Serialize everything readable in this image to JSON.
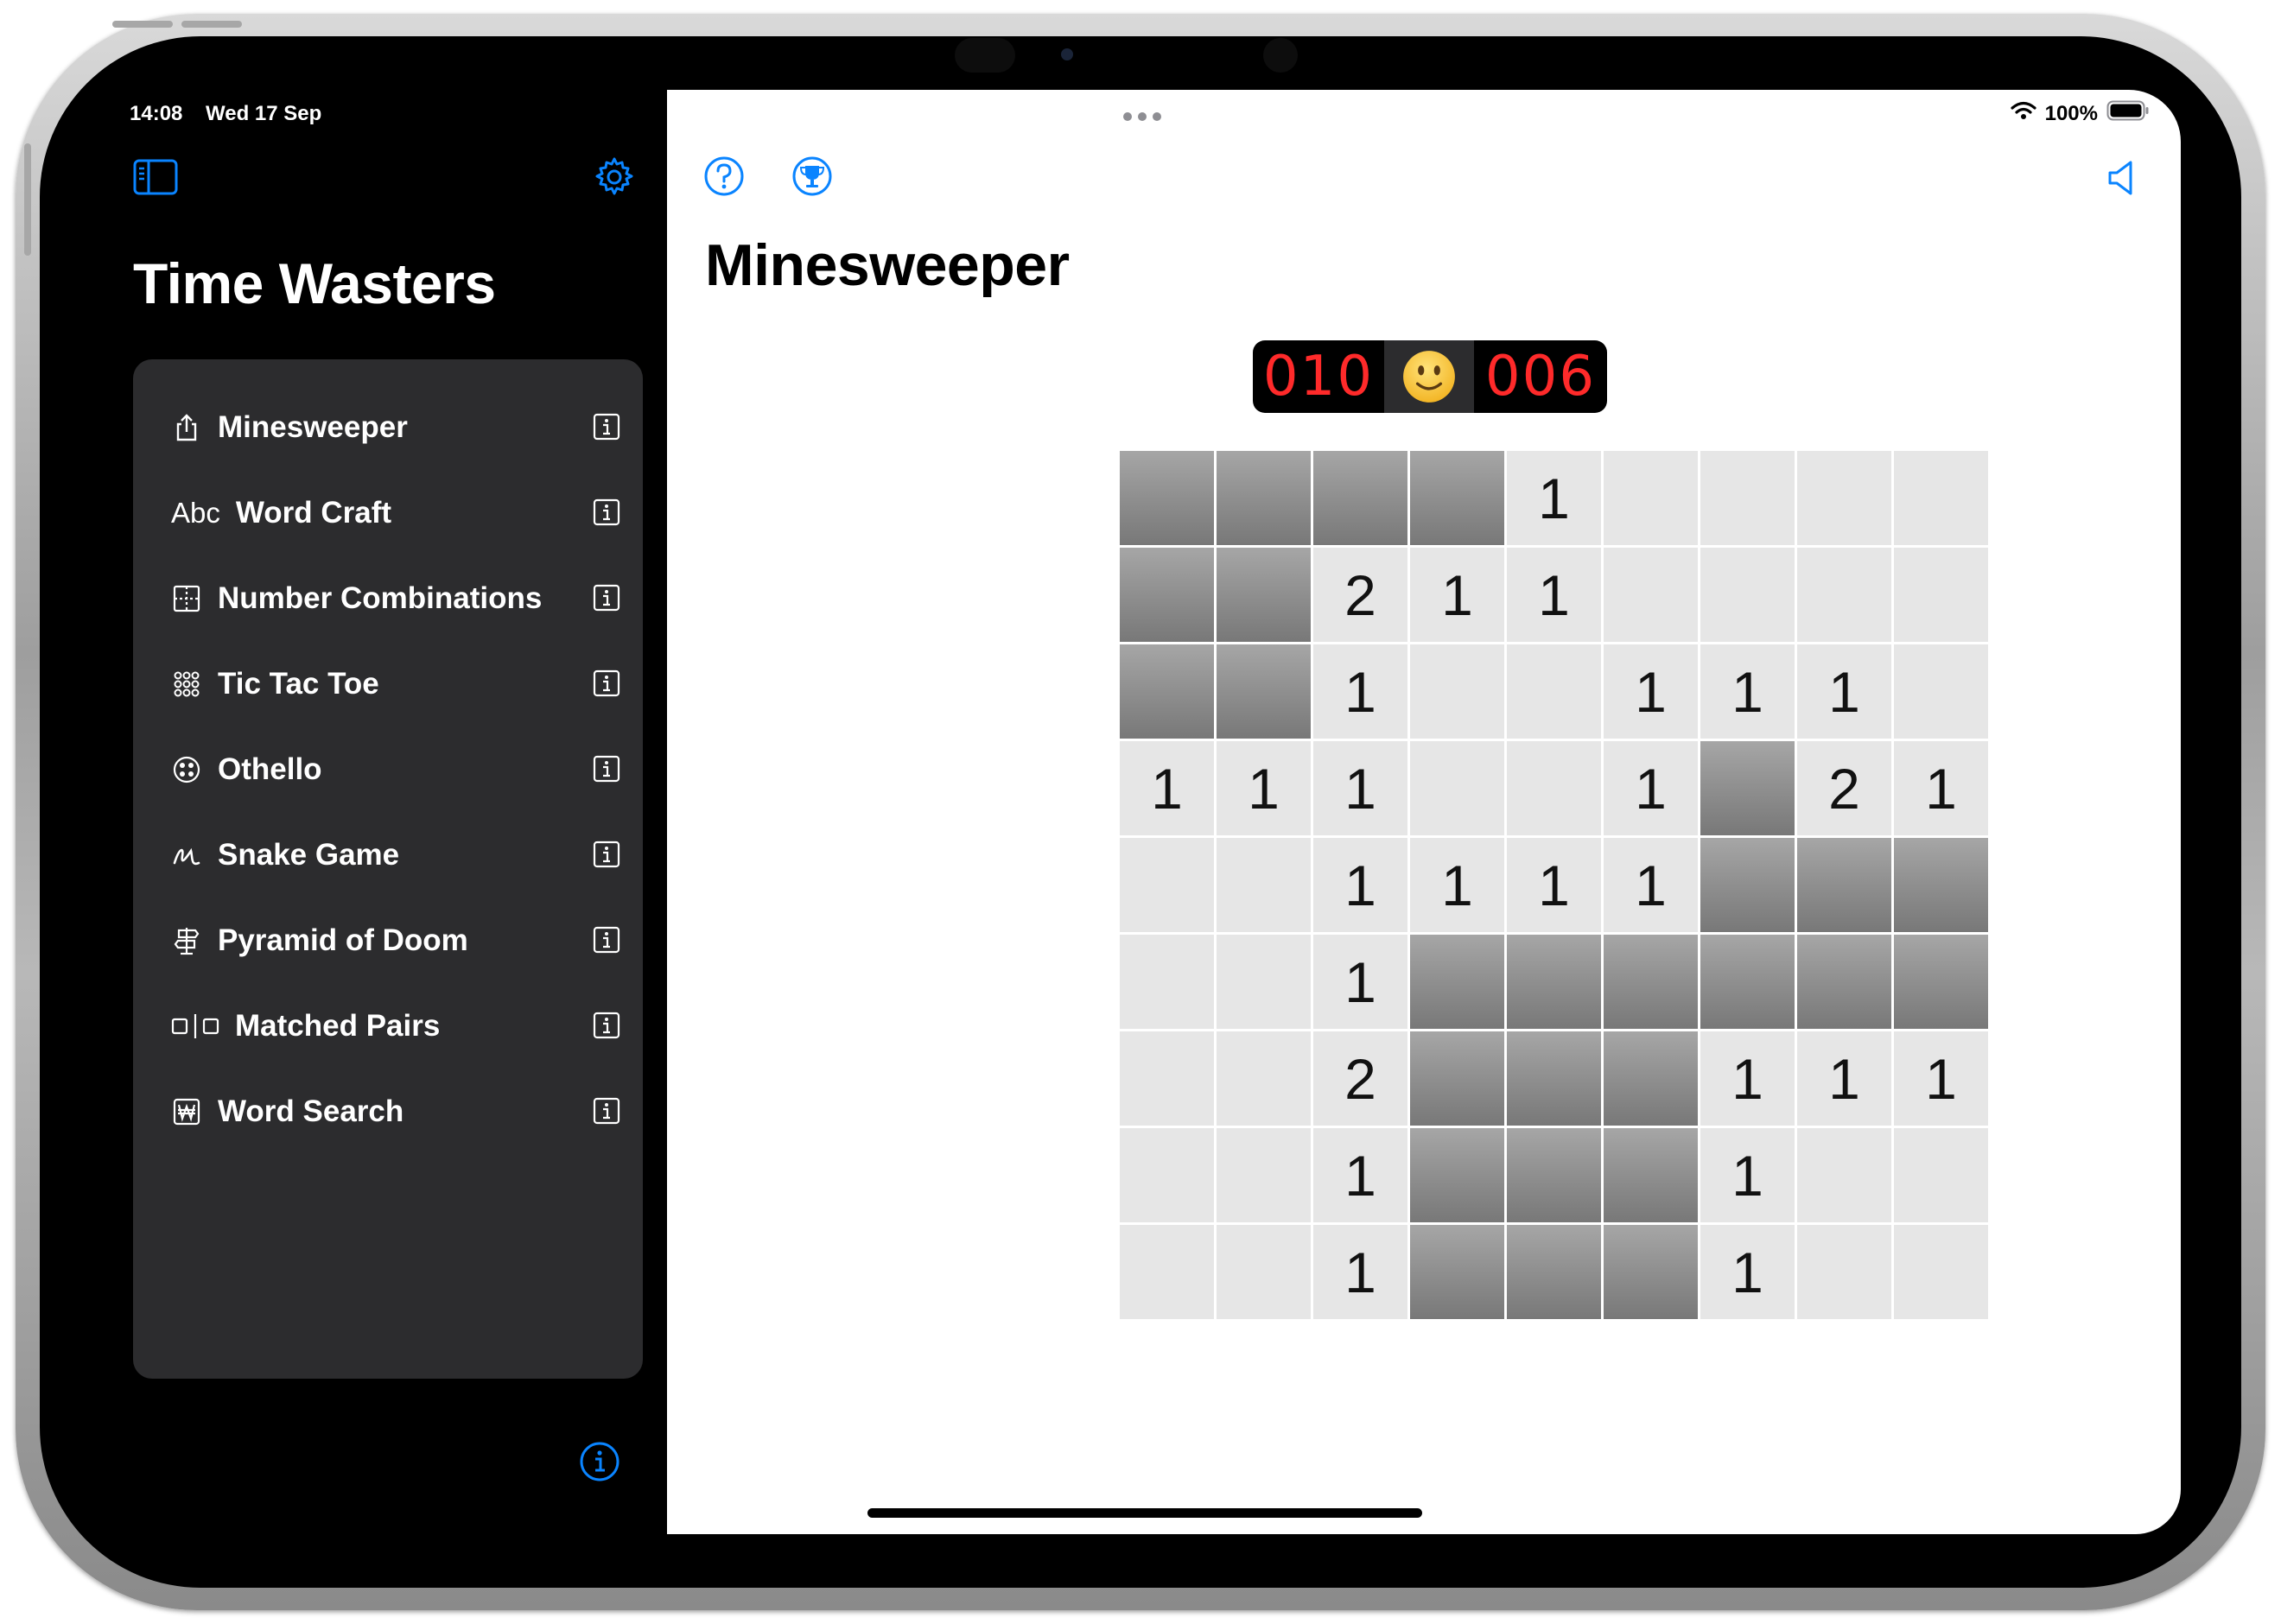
{
  "status_bar": {
    "time": "14:08",
    "date": "Wed 17 Sep",
    "battery": "100%"
  },
  "sidebar": {
    "title": "Time Wasters",
    "items": [
      {
        "label": "Minesweeper",
        "icon": "share-icon"
      },
      {
        "label": "Word Craft",
        "icon": "abc-icon",
        "icon_text": "Abc"
      },
      {
        "label": "Number Combinations",
        "icon": "grid-icon"
      },
      {
        "label": "Tic Tac Toe",
        "icon": "dots-grid-icon"
      },
      {
        "label": "Othello",
        "icon": "othello-icon"
      },
      {
        "label": "Snake Game",
        "icon": "scribble-icon"
      },
      {
        "label": "Pyramid of Doom",
        "icon": "signpost-icon"
      },
      {
        "label": "Matched Pairs",
        "icon": "pairs-icon"
      },
      {
        "label": "Word Search",
        "icon": "won-icon"
      }
    ]
  },
  "main": {
    "title": "Minesweeper",
    "scoreboard": {
      "mines_left": "010",
      "smiley": "🙂",
      "timer": "006"
    },
    "grid": {
      "rows": 9,
      "cols": 9,
      "cells": [
        [
          "#",
          "#",
          "#",
          "#",
          "1",
          "",
          "",
          "",
          ""
        ],
        [
          "#",
          "#",
          "2",
          "1",
          "1",
          "",
          "",
          "",
          ""
        ],
        [
          "#",
          "#",
          "1",
          "",
          "",
          "1",
          "1",
          "1",
          ""
        ],
        [
          "1",
          "1",
          "1",
          "",
          "",
          "1",
          "#",
          "2",
          "1"
        ],
        [
          "",
          "",
          "1",
          "1",
          "1",
          "1",
          "#",
          "#",
          "#"
        ],
        [
          "",
          "",
          "1",
          "#",
          "#",
          "#",
          "#",
          "#",
          "#"
        ],
        [
          "",
          "",
          "2",
          "#",
          "#",
          "#",
          "1",
          "1",
          "1"
        ],
        [
          "",
          "",
          "1",
          "#",
          "#",
          "#",
          "1",
          "",
          ""
        ],
        [
          "",
          "",
          "1",
          "#",
          "#",
          "#",
          "1",
          "",
          ""
        ]
      ]
    }
  },
  "colors": {
    "accent": "#0a84ff",
    "lcd": "#ff2a2a"
  }
}
